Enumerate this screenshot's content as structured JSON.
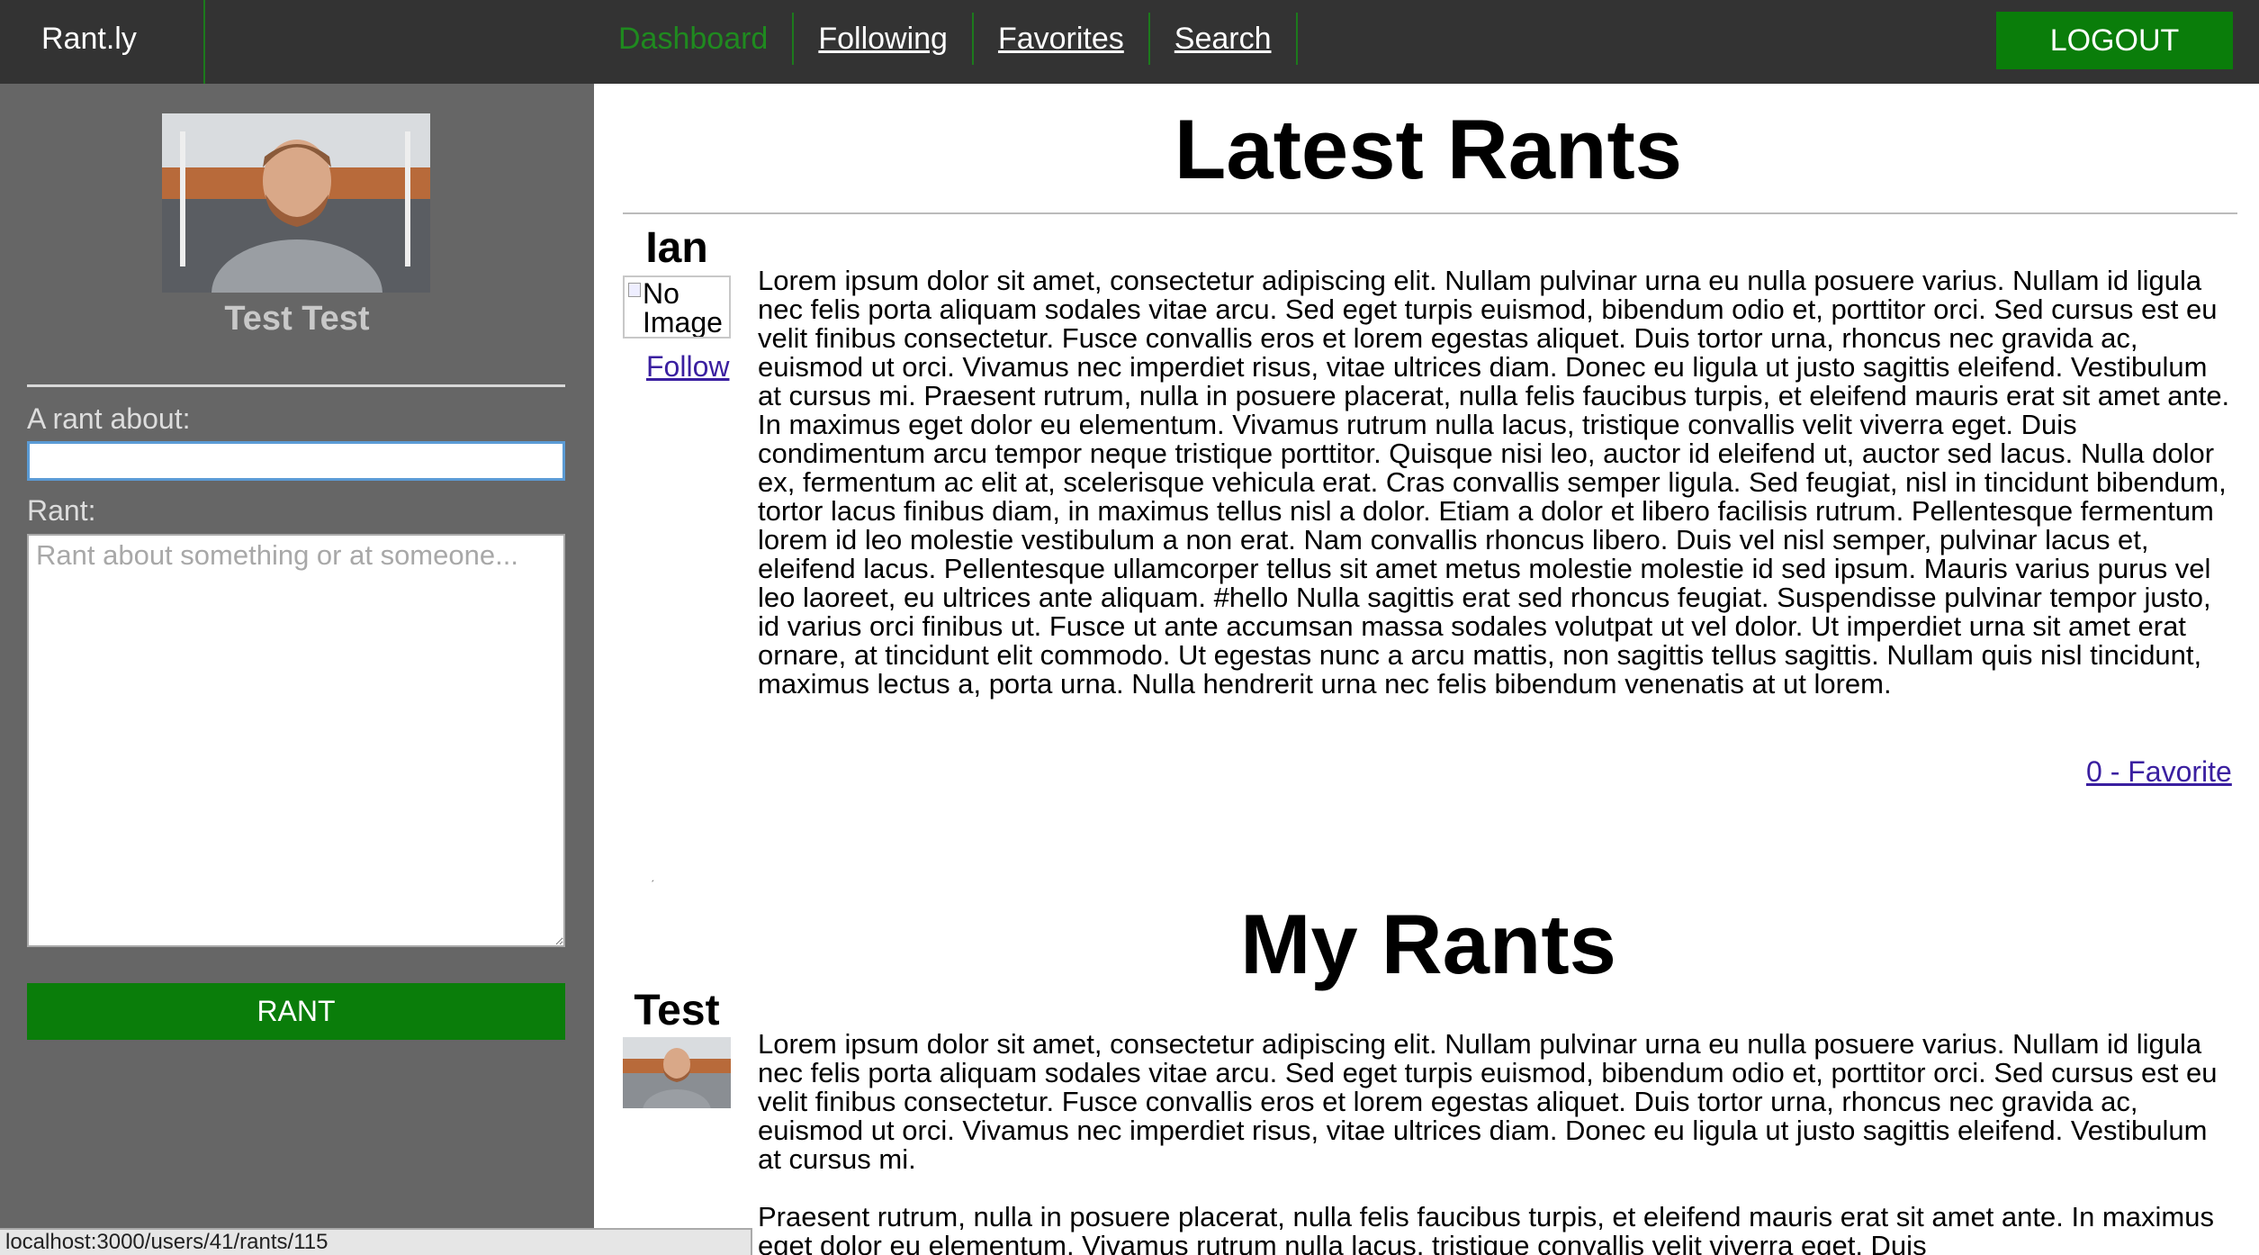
{
  "app": {
    "brand": "Rant.ly"
  },
  "nav": {
    "items": [
      {
        "label": "Dashboard",
        "active": true
      },
      {
        "label": "Following",
        "active": false
      },
      {
        "label": "Favorites",
        "active": false
      },
      {
        "label": "Search",
        "active": false
      }
    ],
    "logout_label": "LOGOUT"
  },
  "sidebar": {
    "profile_name": "Test Test",
    "about_label": "A rant about:",
    "about_value": "",
    "rant_label": "Rant:",
    "rant_placeholder": "Rant about something or at someone...",
    "rant_button": "RANT"
  },
  "latest": {
    "title": "Latest Rants",
    "rant": {
      "author": "Ian",
      "image_alt": "No Image",
      "follow_label": "Follow",
      "body": "Lorem ipsum dolor sit amet, consectetur adipiscing elit. Nullam pulvinar urna eu nulla posuere varius. Nullam id ligula nec felis porta aliquam sodales vitae arcu. Sed eget turpis euismod, bibendum odio et, porttitor orci. Sed cursus est eu velit finibus consectetur. Fusce convallis eros et lorem egestas aliquet. Duis tortor urna, rhoncus nec gravida ac, euismod ut orci. Vivamus nec imperdiet risus, vitae ultrices diam. Donec eu ligula ut justo sagittis eleifend. Vestibulum at cursus mi. Praesent rutrum, nulla in posuere placerat, nulla felis faucibus turpis, et eleifend mauris erat sit amet ante. In maximus eget dolor eu elementum. Vivamus rutrum nulla lacus, tristique convallis velit viverra eget. Duis condimentum arcu tempor neque tristique porttitor. Quisque nisi leo, auctor id eleifend ut, auctor sed lacus. Nulla dolor ex, fermentum ac elit at, scelerisque vehicula erat. Cras convallis semper ligula. Sed feugiat, nisl in tincidunt bibendum, tortor lacus finibus diam, in maximus tellus nisl a dolor. Etiam a dolor et libero facilisis rutrum. Pellentesque fermentum lorem id leo molestie vestibulum a non erat. Nam convallis rhoncus libero. Duis vel nisl semper, pulvinar lacus et, eleifend lacus. Pellentesque ullamcorper tellus sit amet metus molestie molestie id sed ipsum. Mauris varius purus vel leo laoreet, eu ultrices ante aliquam. #hello Nulla sagittis erat sed rhoncus feugiat. Suspendisse pulvinar tempor justo, id varius orci finibus ut. Fusce ut ante accumsan massa sodales volutpat ut vel dolor. Ut imperdiet urna sit amet erat ornare, at tincidunt elit commodo. Ut egestas nunc a arcu mattis, non sagittis tellus sagittis. Nullam quis nisl tincidunt, maximus lectus a, porta urna. Nulla hendrerit urna nec felis bibendum venenatis at ut lorem.",
      "favorite_label": "0 - Favorite"
    },
    "dot": "ˏ"
  },
  "mine": {
    "title": "My Rants",
    "rant": {
      "author": "Test",
      "body_p1": "Lorem ipsum dolor sit amet, consectetur adipiscing elit. Nullam pulvinar urna eu nulla posuere varius. Nullam id ligula nec felis porta aliquam sodales vitae arcu. Sed eget turpis euismod, bibendum odio et, porttitor orci. Sed cursus est eu velit finibus consectetur. Fusce convallis eros et lorem egestas aliquet. Duis tortor urna, rhoncus nec gravida ac, euismod ut orci. Vivamus nec imperdiet risus, vitae ultrices diam. Donec eu ligula ut justo sagittis eleifend. Vestibulum at cursus mi.",
      "body_p2": "Praesent rutrum, nulla in posuere placerat, nulla felis faucibus turpis, et eleifend mauris erat sit amet ante. In maximus eget dolor eu elementum. Vivamus rutrum nulla lacus, tristique convallis velit viverra eget. Duis"
    }
  },
  "status_url": "localhost:3000/users/41/rants/115",
  "colors": {
    "topbar": "#333333",
    "sidebar": "#666666",
    "accent_green": "#0a7d0a",
    "link_visited": "#3a1fa0"
  }
}
